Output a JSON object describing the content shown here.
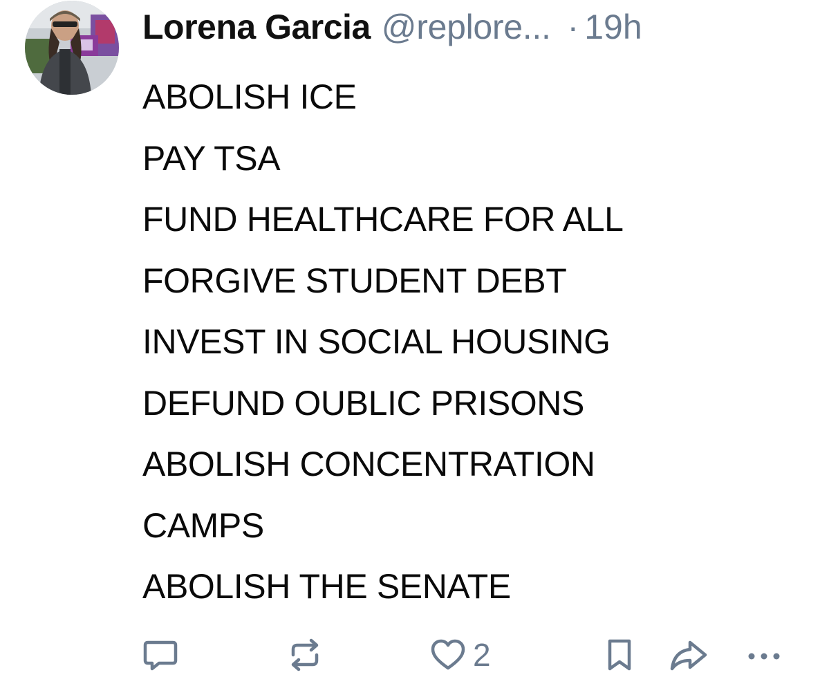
{
  "author": {
    "display_name": "Lorena Garcia",
    "handle": "@replore...",
    "separator": "·",
    "timestamp": "19h"
  },
  "post": {
    "lines": [
      "ABOLISH ICE",
      "PAY TSA",
      "FUND HEALTHCARE FOR ALL",
      "FORGIVE STUDENT DEBT",
      "INVEST IN SOCIAL HOUSING",
      "DEFUND OUBLIC PRISONS",
      "ABOLISH CONCENTRATION",
      "CAMPS",
      "ABOLISH THE SENATE"
    ]
  },
  "actions": {
    "reply_icon": "reply-bubble-icon",
    "repost_icon": "repost-icon",
    "like_icon": "heart-icon",
    "like_count": "2",
    "bookmark_icon": "bookmark-icon",
    "share_icon": "share-arrow-icon",
    "more_icon": "ellipsis-icon"
  },
  "colors": {
    "text": "#0a0a0a",
    "secondary": "#6b7b8f",
    "background": "#ffffff"
  }
}
